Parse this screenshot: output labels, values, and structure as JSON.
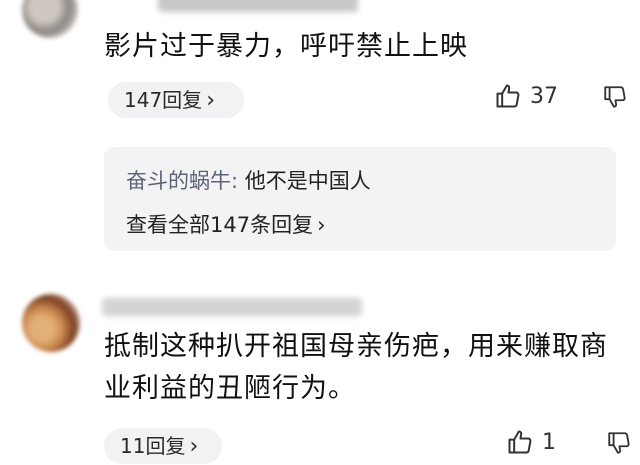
{
  "comments": [
    {
      "text": "影片过于暴力，呼吁禁止上映",
      "replies_label": "147回复",
      "likes": "37",
      "reply_preview": {
        "author": "奋斗的蜗牛:",
        "text": " 他不是中国人",
        "view_all": "查看全部147条回复"
      }
    },
    {
      "text": "抵制这种扒开祖国母亲伤疤，用来赚取商业利益的丑陋行为。",
      "replies_label": "11回复",
      "likes": "1"
    }
  ],
  "icons": {
    "like": "thumbs-up-icon",
    "dislike": "thumbs-down-icon",
    "chevron": "chevron-right-icon"
  },
  "glyphs": {
    "chevron": "›"
  }
}
